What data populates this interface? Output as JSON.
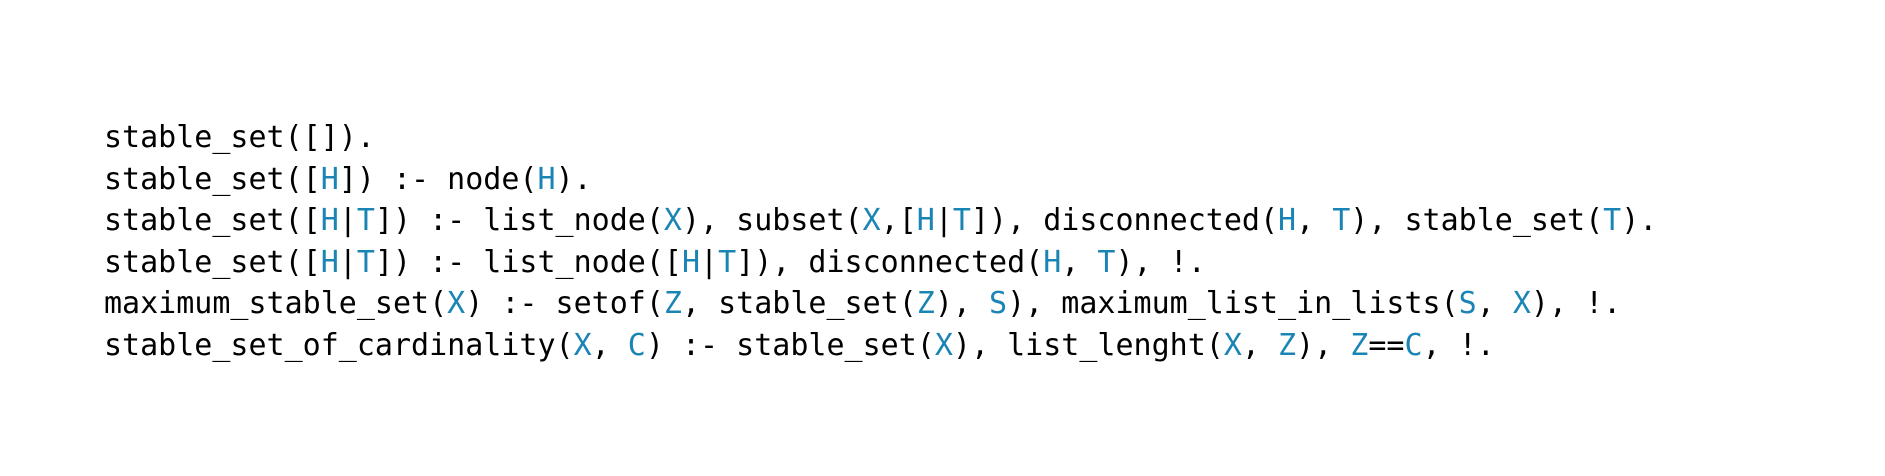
{
  "colors": {
    "text": "#000000",
    "variable": "#1a85b5",
    "background": "#ffffff"
  },
  "code": {
    "lines": [
      [
        {
          "t": "stable_set([])."
        }
      ],
      [
        {
          "t": "stable_set(["
        },
        {
          "t": "H",
          "v": true
        },
        {
          "t": "]) :- node("
        },
        {
          "t": "H",
          "v": true
        },
        {
          "t": ")."
        }
      ],
      [
        {
          "t": "stable_set(["
        },
        {
          "t": "H",
          "v": true
        },
        {
          "t": "|"
        },
        {
          "t": "T",
          "v": true
        },
        {
          "t": "]) :- list_node("
        },
        {
          "t": "X",
          "v": true
        },
        {
          "t": "), subset("
        },
        {
          "t": "X",
          "v": true
        },
        {
          "t": ",["
        },
        {
          "t": "H",
          "v": true
        },
        {
          "t": "|"
        },
        {
          "t": "T",
          "v": true
        },
        {
          "t": "]), disconnected("
        },
        {
          "t": "H",
          "v": true
        },
        {
          "t": ", "
        },
        {
          "t": "T",
          "v": true
        },
        {
          "t": "), stable_set("
        },
        {
          "t": "T",
          "v": true
        },
        {
          "t": ")."
        }
      ],
      [
        {
          "t": "stable_set(["
        },
        {
          "t": "H",
          "v": true
        },
        {
          "t": "|"
        },
        {
          "t": "T",
          "v": true
        },
        {
          "t": "]) :- list_node(["
        },
        {
          "t": "H",
          "v": true
        },
        {
          "t": "|"
        },
        {
          "t": "T",
          "v": true
        },
        {
          "t": "]), disconnected("
        },
        {
          "t": "H",
          "v": true
        },
        {
          "t": ", "
        },
        {
          "t": "T",
          "v": true
        },
        {
          "t": "), !."
        }
      ],
      [
        {
          "t": "maximum_stable_set("
        },
        {
          "t": "X",
          "v": true
        },
        {
          "t": ") :- setof("
        },
        {
          "t": "Z",
          "v": true
        },
        {
          "t": ", stable_set("
        },
        {
          "t": "Z",
          "v": true
        },
        {
          "t": "), "
        },
        {
          "t": "S",
          "v": true
        },
        {
          "t": "), maximum_list_in_lists("
        },
        {
          "t": "S",
          "v": true
        },
        {
          "t": ", "
        },
        {
          "t": "X",
          "v": true
        },
        {
          "t": "), !."
        }
      ],
      [
        {
          "t": "stable_set_of_cardinality("
        },
        {
          "t": "X",
          "v": true
        },
        {
          "t": ", "
        },
        {
          "t": "C",
          "v": true
        },
        {
          "t": ") :- stable_set("
        },
        {
          "t": "X",
          "v": true
        },
        {
          "t": "), list_lenght("
        },
        {
          "t": "X",
          "v": true
        },
        {
          "t": ", "
        },
        {
          "t": "Z",
          "v": true
        },
        {
          "t": "), "
        },
        {
          "t": "Z",
          "v": true
        },
        {
          "t": "=="
        },
        {
          "t": "C",
          "v": true
        },
        {
          "t": ", !."
        }
      ]
    ]
  }
}
